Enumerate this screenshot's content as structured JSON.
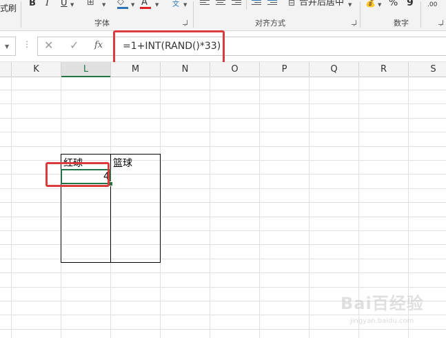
{
  "ribbon": {
    "clipboard_fragment": "式刷",
    "bold": "B",
    "italic": "I",
    "underline": "U",
    "font_color_letter": "A",
    "phonetic_label": "文",
    "merge_center": "合并后居中",
    "percent": "%",
    "comma_style": "9",
    "decimal_label": ".00",
    "group_font": "字体",
    "group_alignment": "对齐方式",
    "group_number": "数字",
    "colors": {
      "fill_color": "#2f75b5",
      "font_color": "#e02020"
    }
  },
  "formula_bar": {
    "fx_label": "fx",
    "cancel_glyph": "✕",
    "enter_glyph": "✓",
    "formula": "=1+INT(RAND()*33)"
  },
  "columns": [
    "K",
    "L",
    "M",
    "N",
    "O",
    "P",
    "Q",
    "R",
    "S"
  ],
  "selected_column": "L",
  "cells": {
    "header_left": "红球",
    "header_right": "篮球",
    "value": "4"
  },
  "annotation_color": "#dd3b3b",
  "watermark": {
    "brand": "Bai百经验",
    "url": "jingyan.baidu.com"
  }
}
